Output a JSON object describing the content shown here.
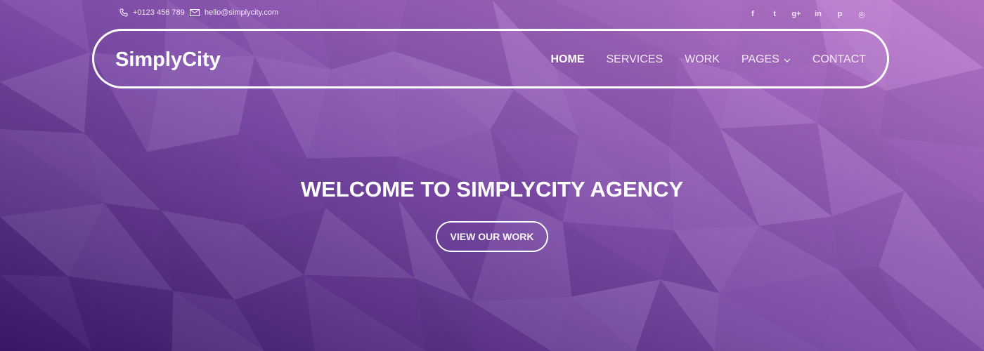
{
  "theme": {
    "gradient_dark": "#3a1a68",
    "gradient_mid": "#7a4aa6",
    "gradient_light": "#c07ccf",
    "line_color": "#ffffff"
  },
  "topbar": {
    "phone": {
      "icon": "phone-icon",
      "text": "+0123 456 789"
    },
    "email": {
      "icon": "mail-icon",
      "text": "hello@simplycity.com"
    },
    "socials": [
      {
        "name": "facebook-icon",
        "glyph": "f"
      },
      {
        "name": "twitter-icon",
        "glyph": "t"
      },
      {
        "name": "google-plus-icon",
        "glyph": "g+"
      },
      {
        "name": "linkedin-icon",
        "glyph": "in"
      },
      {
        "name": "pinterest-icon",
        "glyph": "p"
      },
      {
        "name": "dribbble-icon",
        "glyph": "◎"
      }
    ]
  },
  "navbar": {
    "brand": "SimplyCity",
    "menu": [
      {
        "label": "HOME",
        "active": true
      },
      {
        "label": "SERVICES"
      },
      {
        "label": "WORK"
      },
      {
        "label": "PAGES",
        "dropdown": true
      },
      {
        "label": "CONTACT"
      }
    ]
  },
  "hero": {
    "title": "WELCOME TO SIMPLYCITY AGENCY",
    "cta_label": "VIEW OUR WORK"
  }
}
